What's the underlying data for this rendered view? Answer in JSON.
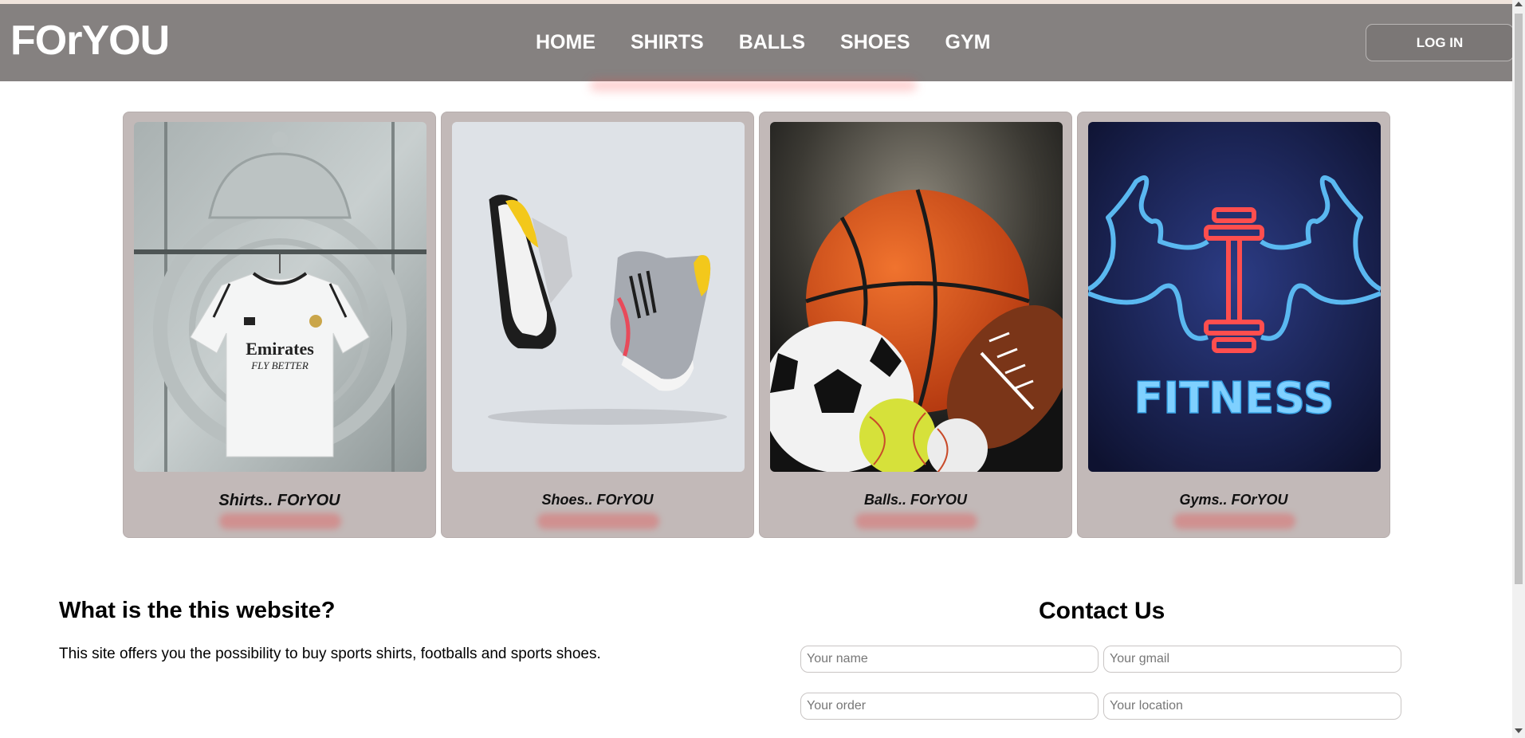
{
  "header": {
    "logo": "FOrYOU",
    "nav": [
      "HOME",
      "SHIRTS",
      "BALLS",
      "SHOES",
      "GYM"
    ],
    "login_label": "LOG IN",
    "bg_color": "#858180"
  },
  "cards": [
    {
      "title": "Shirts.. FOrYOU",
      "image": "real-madrid-shirt-image"
    },
    {
      "title": "Shoes.. FOrYOU",
      "image": "sneakers-image"
    },
    {
      "title": "Balls.. FOrYOU",
      "image": "sports-balls-image"
    },
    {
      "title": "Gyms.. FOrYOU",
      "image": "neon-fitness-image"
    }
  ],
  "images": {
    "shirt_sponsor": "Emirates",
    "shirt_slogan": "FLY BETTER",
    "fitness_text": "FITNESS"
  },
  "about": {
    "title": "What is the this website?",
    "text": "This site offers you the possibility to buy sports shirts, footballs and sports shoes."
  },
  "contact": {
    "title": "Contact Us",
    "placeholders": {
      "name": "Your name",
      "gmail": "Your gmail",
      "order": "Your order",
      "location": "Your location"
    }
  },
  "colors": {
    "card_bg": "#c2b9b8",
    "accent_blur": "#eb4646"
  }
}
